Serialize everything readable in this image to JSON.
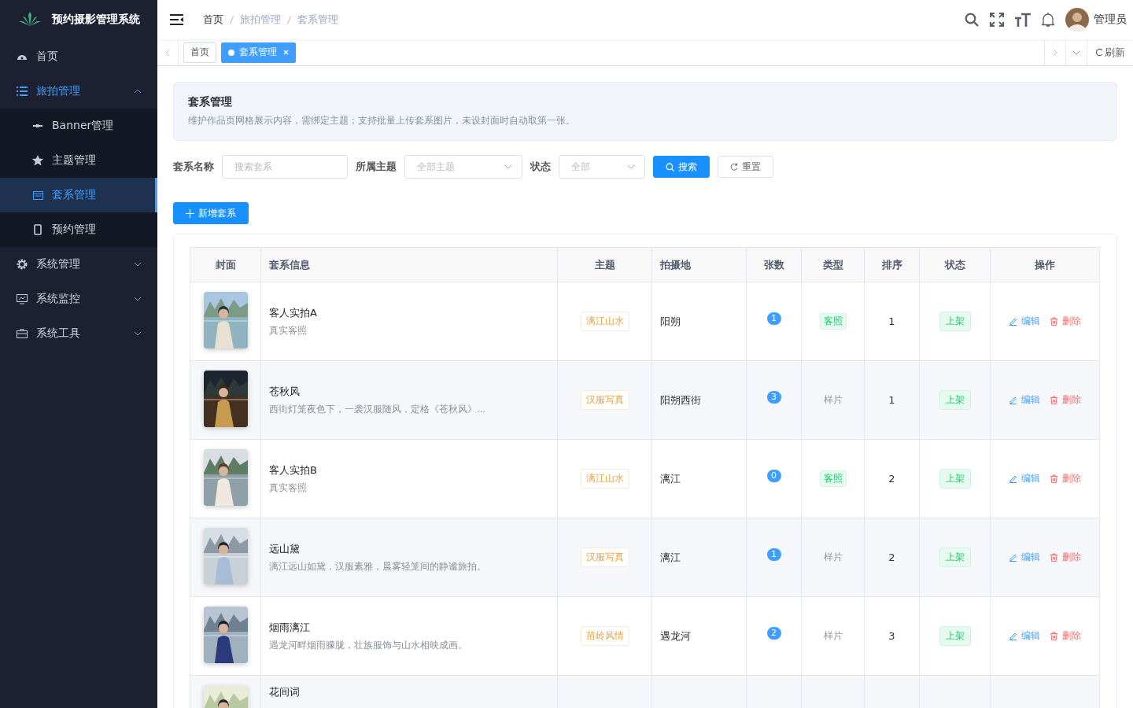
{
  "sidebar": {
    "title": "预约摄影管理系统",
    "items": [
      {
        "label": "首页",
        "selected": false
      },
      {
        "label": "旅拍管理",
        "expanded": true,
        "children": [
          {
            "label": "Banner管理",
            "selected": false
          },
          {
            "label": "主题管理",
            "selected": false
          },
          {
            "label": "套系管理",
            "selected": true
          },
          {
            "label": "预约管理",
            "selected": false
          }
        ]
      },
      {
        "label": "系统管理",
        "expanded": false
      },
      {
        "label": "系统监控",
        "expanded": false
      },
      {
        "label": "系统工具",
        "expanded": false
      }
    ]
  },
  "header": {
    "breadcrumb": [
      "首页",
      "旅拍管理",
      "套系管理"
    ],
    "user": "管理员"
  },
  "tabs": [
    {
      "label": "首页",
      "selected": false
    },
    {
      "label": "套系管理",
      "selected": true
    }
  ],
  "refresh": "刷新",
  "notice": {
    "title": "套系管理",
    "text": "维护作品页网格展示内容，需绑定主题；支持批量上传套系图片，未设封面时自动取第一张。"
  },
  "filters": [
    {
      "label": "套系名称",
      "placeholder": "搜索套系",
      "kind": "input"
    },
    {
      "label": "所属主题",
      "placeholder": "全部主题",
      "kind": "select"
    },
    {
      "label": "状态",
      "placeholder": "全部",
      "kind": "select"
    }
  ],
  "search_button": "搜索",
  "reset_button": "重置",
  "add_button": "新增套系",
  "table": {
    "columns": [
      "封面",
      "套系信息",
      "主题",
      "拍摄地",
      "张数",
      "类型",
      "排序",
      "状态",
      "操作"
    ],
    "rows": [
      {
        "title": "客人实拍A",
        "desc": "真实客照",
        "theme": "漓江山水",
        "location": "阳朔",
        "count": "1",
        "type": {
          "text": "客照",
          "tagged": true
        },
        "sort": "1",
        "status": "上架",
        "actions": [
          "编辑",
          "删除"
        ]
      },
      {
        "title": "苍秋风",
        "desc": "西街灯笼夜色下，一袭汉服随风，定格《苍秋风》...",
        "theme": "汉服写真",
        "location": "阳朔西街",
        "count": "3",
        "type": {
          "text": "样片",
          "tagged": false
        },
        "sort": "1",
        "status": "上架",
        "actions": [
          "编辑",
          "删除"
        ]
      },
      {
        "title": "客人实拍B",
        "desc": "真实客照",
        "theme": "漓江山水",
        "location": "漓江",
        "count": "0",
        "type": {
          "text": "客照",
          "tagged": true
        },
        "sort": "2",
        "status": "上架",
        "actions": [
          "编辑",
          "删除"
        ]
      },
      {
        "title": "远山黛",
        "desc": "漓江远山如黛，汉服素雅，晨雾轻笼间的静谧旅拍。",
        "theme": "汉服写真",
        "location": "漓江",
        "count": "1",
        "type": {
          "text": "样片",
          "tagged": false
        },
        "sort": "2",
        "status": "上架",
        "actions": [
          "编辑",
          "删除"
        ]
      },
      {
        "title": "烟雨漓江",
        "desc": "遇龙河畔烟雨朦胧，壮族服饰与山水相映成画。",
        "theme": "苗岭风情",
        "location": "遇龙河",
        "count": "2",
        "type": {
          "text": "样片",
          "tagged": false
        },
        "sort": "3",
        "status": "上架",
        "actions": [
          "编辑",
          "删除"
        ]
      },
      {
        "title": "花间词"
      }
    ]
  }
}
